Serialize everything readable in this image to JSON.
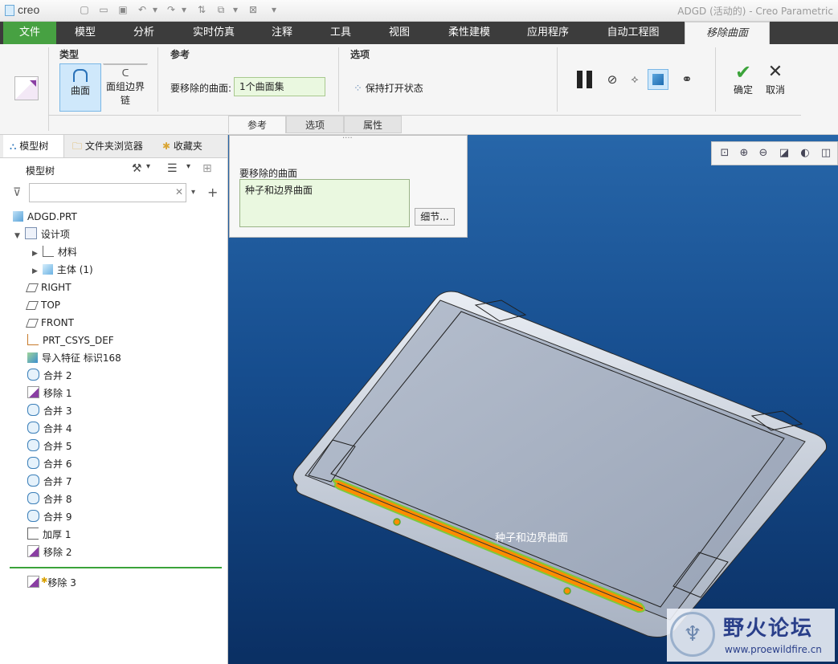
{
  "app": {
    "logo": "creo",
    "title": "ADGD (活动的) - Creo Parametric"
  },
  "menu": {
    "tabs": [
      "文件",
      "模型",
      "分析",
      "实时仿真",
      "注释",
      "工具",
      "视图",
      "柔性建模",
      "应用程序",
      "自动工程图",
      "移除曲面"
    ]
  },
  "ribbon": {
    "type_group": {
      "label": "类型",
      "surface": "曲面",
      "boundary_line1": "面组边界",
      "boundary_line2": "链"
    },
    "ref_group": {
      "label": "参考",
      "field_label": "要移除的曲面:",
      "field_value": "1个曲面集"
    },
    "options_group": {
      "label": "选项",
      "keep_open": "保持打开状态"
    },
    "confirm": "确定",
    "cancel": "取消",
    "subtabs": [
      "参考",
      "选项",
      "属性"
    ]
  },
  "popup": {
    "grip": "····",
    "label": "要移除的曲面",
    "value": "种子和边界曲面",
    "details_button": "细节..."
  },
  "left_panel": {
    "tabs": [
      "模型树",
      "文件夹浏览器",
      "收藏夹"
    ],
    "header": "模型树",
    "filter_placeholder": "",
    "items": [
      "ADGD.PRT",
      "设计项",
      "材料",
      "主体 (1)",
      "RIGHT",
      "TOP",
      "FRONT",
      "PRT_CSYS_DEF",
      "导入特征 标识168",
      "合并 2",
      "移除 1",
      "合并 3",
      "合并 4",
      "合并 5",
      "合并 6",
      "合并 7",
      "合并 8",
      "合并 9",
      "加厚 1",
      "移除 2"
    ],
    "inserted_item": "移除 3"
  },
  "viewport": {
    "label": "种子和边界曲面",
    "watermark_title": "野火论坛",
    "watermark_url": "www.proewildfire.cn"
  },
  "colors": {
    "menu_bg": "#3c3c3c",
    "file_tab": "#47a142",
    "accent_green": "#3ba33a",
    "highlight_orange": "#ff8c00",
    "viewport_top": "#2766a9",
    "viewport_bottom": "#0a2f63"
  }
}
